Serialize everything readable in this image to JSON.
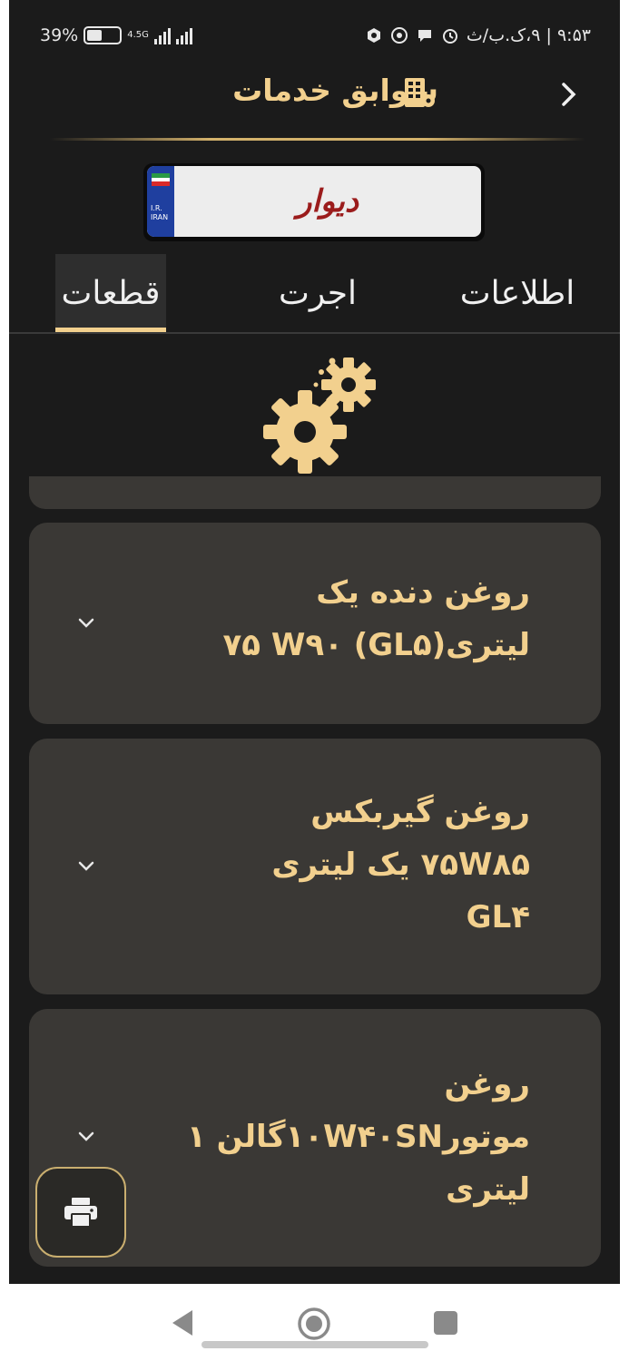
{
  "status_bar": {
    "battery_percent": "39%",
    "network_type": "4.5G",
    "time_date": "۹:۵۳ | ۹،ک.ب/ث",
    "icons": [
      "battery-icon",
      "signal-icon",
      "signal-icon",
      "vpn-icon",
      "whatsapp-icon",
      "message-icon",
      "alarm-icon"
    ]
  },
  "header": {
    "title": "سوابق خدمات",
    "title_icon": "building-icon",
    "back_icon": "chevron-right-icon"
  },
  "plate": {
    "text": "دیوار",
    "country_code": "I.R.\nIRAN"
  },
  "tabs": [
    {
      "label": "اطلاعات",
      "active": false
    },
    {
      "label": "اجرت",
      "active": false
    },
    {
      "label": "قطعات",
      "active": true
    }
  ],
  "section_icon": "gears-icon",
  "parts": [
    {
      "label": "روغن دنده یک\nلیتری(GL۵) ۷۵ W۹۰"
    },
    {
      "label": "روغن گیربکس\n۷۵W۸۵ یک لیتری\nGL۴"
    },
    {
      "label": "روغن\nموتور۱۰W۴۰SNگالن ۱\nلیتری"
    }
  ],
  "print_button": {
    "icon": "printer-icon"
  },
  "colors": {
    "background": "#1b1b1b",
    "card": "#3a3835",
    "accent_gold": "#f2d08e",
    "plate_text": "#9b1c1c"
  }
}
